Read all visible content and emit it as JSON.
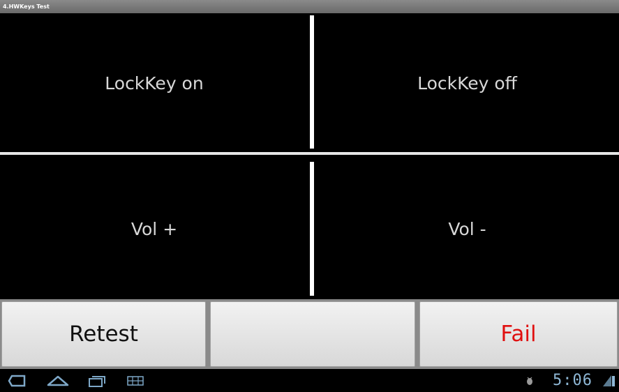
{
  "window": {
    "title": "4.HWKeys Test"
  },
  "keys": {
    "lock_on": "LockKey on",
    "lock_off": "LockKey off",
    "vol_up": "Vol +",
    "vol_down": "Vol -"
  },
  "buttons": {
    "retest": "Retest",
    "middle": "",
    "fail": "Fail"
  },
  "colors": {
    "fail_text": "#e01010",
    "accent_blue": "#8fb8d6"
  },
  "statusbar": {
    "time": "5:06",
    "icons": [
      "back-icon",
      "home-icon",
      "recent-apps-icon",
      "menu-grid-icon",
      "usb-debug-icon",
      "signal-icon"
    ]
  }
}
